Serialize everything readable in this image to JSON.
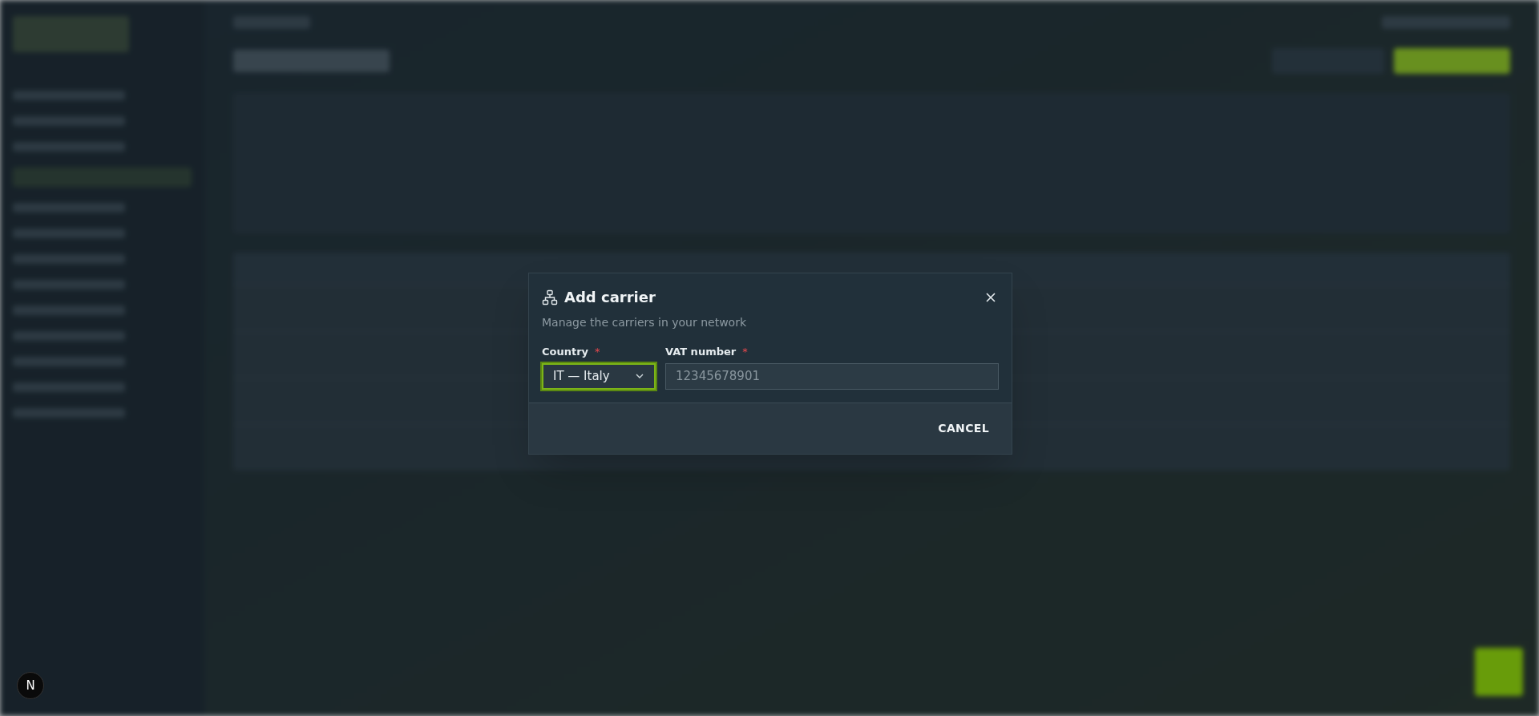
{
  "dialog": {
    "title": "Add carrier",
    "subtitle": "Manage the carriers in your network",
    "fields": [
      {
        "kind": "select",
        "label": "Country",
        "required_mark": "*",
        "value": "IT — Italy",
        "focused": true
      },
      {
        "kind": "text",
        "label": "VAT number",
        "required_mark": "*",
        "placeholder": "12345678901",
        "focused": false
      }
    ],
    "buttons": [
      "CANCEL"
    ]
  },
  "dev_badge": {
    "label": "N"
  }
}
